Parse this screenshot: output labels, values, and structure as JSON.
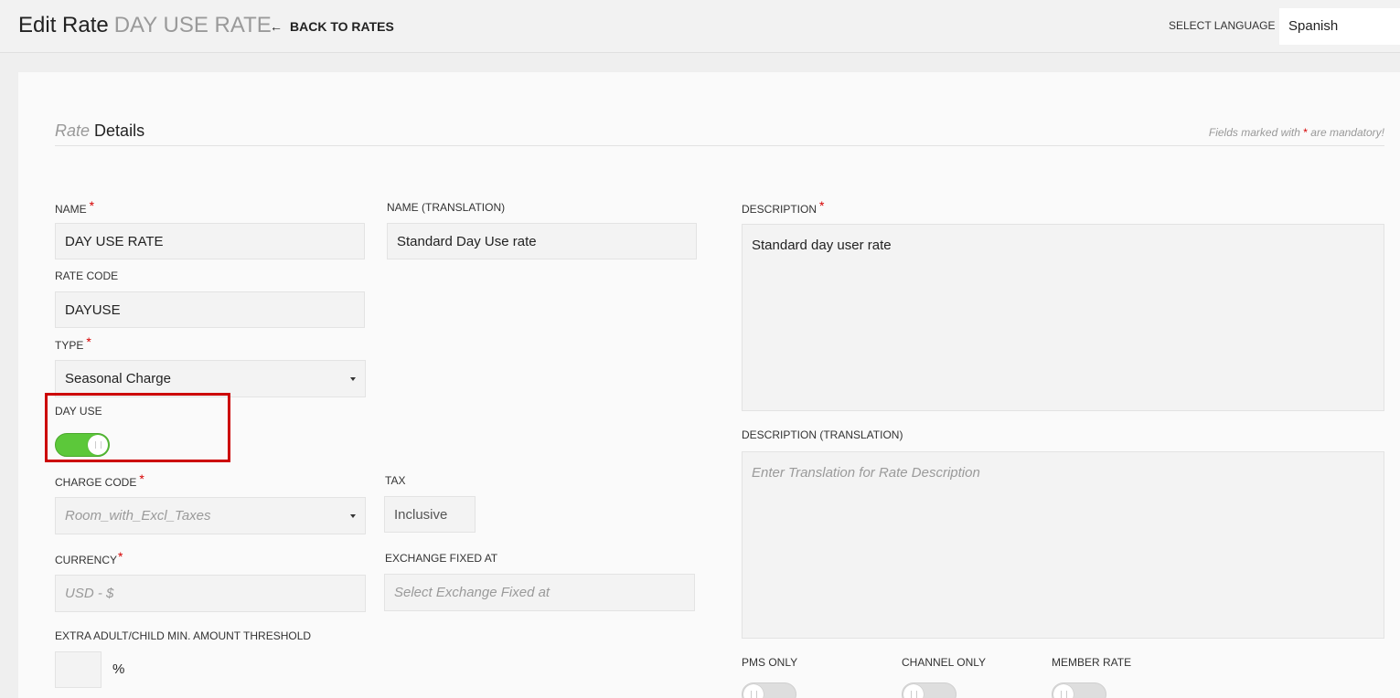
{
  "header": {
    "title": "Edit Rate",
    "subtitle": "DAY USE RATE",
    "back_label": "BACK TO RATES",
    "language_label": "SELECT LANGUAGE",
    "language_value": "Spanish"
  },
  "section": {
    "title_light": "Rate",
    "title_bold": "Details",
    "note_prefix": "Fields marked with",
    "note_star": "*",
    "note_suffix": "are mandatory!"
  },
  "form": {
    "name": {
      "label": "NAME",
      "required": "*",
      "value": "DAY USE RATE"
    },
    "name_translation": {
      "label": "NAME (TRANSLATION)",
      "value": "Standard Day Use rate"
    },
    "rate_code": {
      "label": "RATE CODE",
      "value": "DAYUSE"
    },
    "type": {
      "label": "TYPE",
      "required": "*",
      "value": "Seasonal Charge"
    },
    "day_use": {
      "label": "DAY USE",
      "enabled": true
    },
    "charge_code": {
      "label": "CHARGE CODE",
      "required": "*",
      "placeholder": "Room_with_Excl_Taxes"
    },
    "tax": {
      "label": "TAX",
      "value": "Inclusive"
    },
    "currency": {
      "label": "CURRENCY",
      "required": "*",
      "placeholder": "USD - $"
    },
    "exchange_fixed_at": {
      "label": "EXCHANGE FIXED AT",
      "placeholder": "Select Exchange Fixed at"
    },
    "threshold": {
      "label": "EXTRA ADULT/CHILD MIN. AMOUNT THRESHOLD",
      "value": "",
      "unit": "%"
    },
    "description": {
      "label": "DESCRIPTION",
      "required": "*",
      "value": "Standard day user rate"
    },
    "description_translation": {
      "label": "DESCRIPTION (TRANSLATION)",
      "placeholder": "Enter Translation for Rate Description"
    },
    "pms_only": {
      "label": "PMS ONLY",
      "enabled": false
    },
    "channel_only": {
      "label": "CHANNEL ONLY",
      "enabled": false
    },
    "member_rate": {
      "label": "MEMBER RATE",
      "enabled": false
    }
  },
  "colors": {
    "toggle_on": "#5cc83a",
    "required": "#d60000",
    "highlight_box": "#cc0000"
  }
}
